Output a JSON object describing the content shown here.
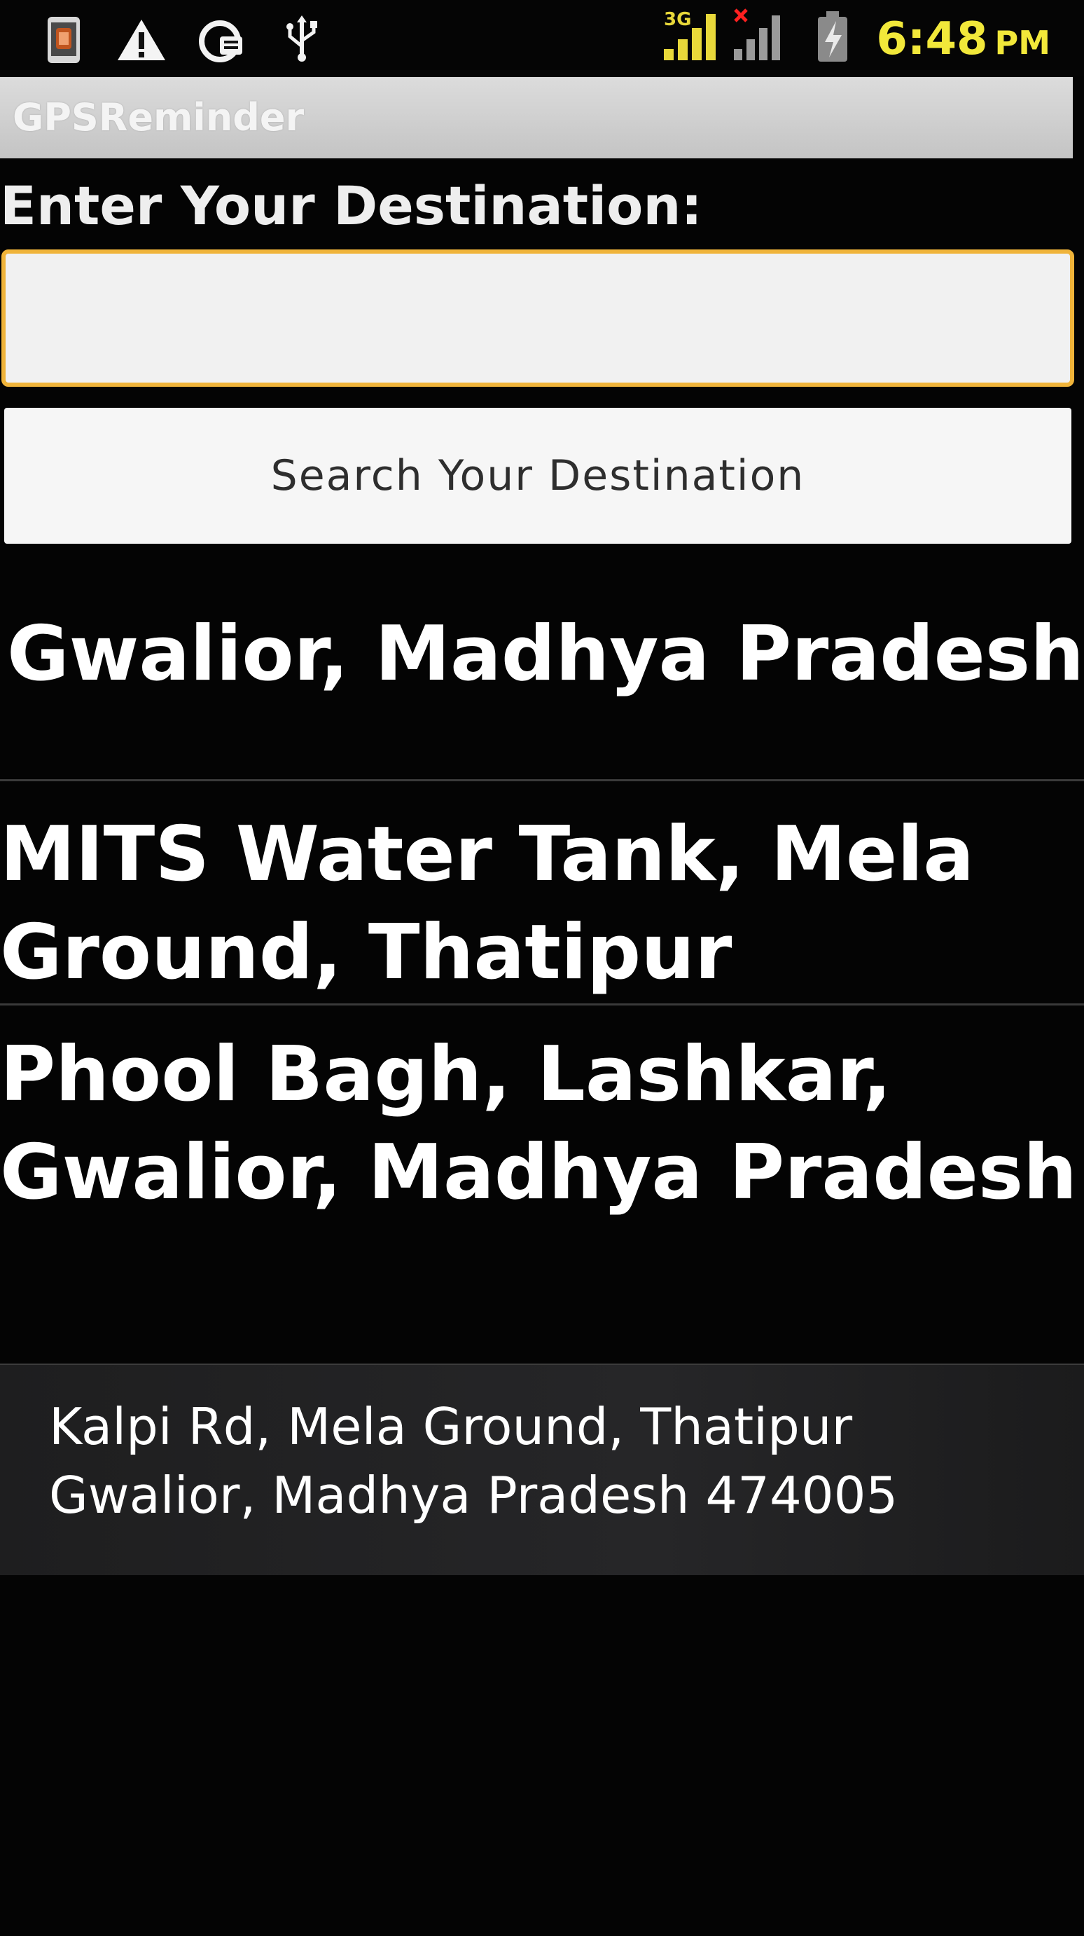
{
  "status_bar": {
    "time": "6:48",
    "ampm": "PM",
    "network": "3G",
    "icons": [
      "app-notification-icon",
      "warning-icon",
      "sync-icon",
      "usb-icon",
      "signal-3g-icon",
      "signal-no-sim-icon",
      "battery-charging-icon"
    ],
    "colors": {
      "clock": "#f2e83a",
      "signal": "#e8d83a",
      "no_signal_x": "#ff2020"
    }
  },
  "app": {
    "title": "GPSReminder"
  },
  "destination": {
    "label": "Enter Your Destination:",
    "value": "",
    "placeholder": "",
    "focus_color": "#f0b43a"
  },
  "search_button": {
    "label": "Search Your Destination"
  },
  "results": [
    {
      "lines": [
        "Gwalior, Madhya Pradesh"
      ]
    },
    {
      "lines": [
        "MITS Water Tank, Mela",
        "Ground, Thatipur"
      ]
    },
    {
      "lines": [
        "Phool Bagh, Lashkar,",
        "Gwalior, Madhya Pradesh"
      ]
    }
  ],
  "address": {
    "lines": [
      "Kalpi Rd, Mela Ground, Thatipur",
      "Gwalior, Madhya Pradesh 474005"
    ]
  }
}
